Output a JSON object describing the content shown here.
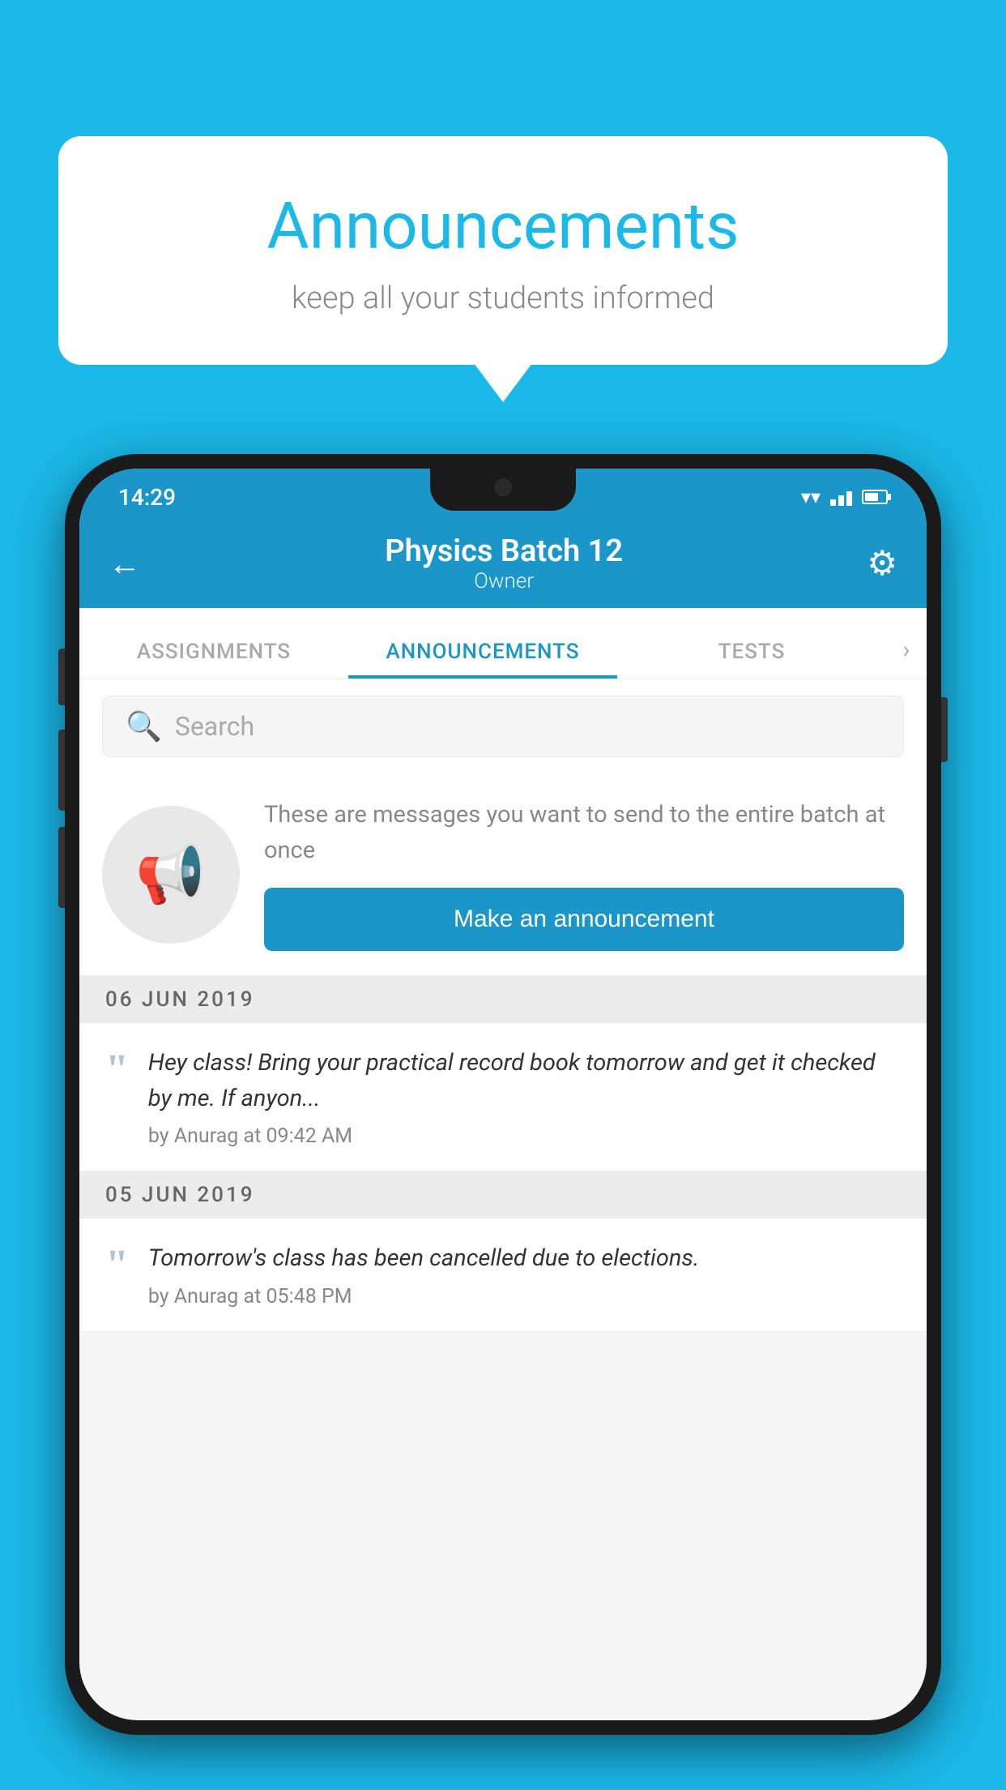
{
  "background_color": "#1BB8E8",
  "speech_bubble": {
    "title": "Announcements",
    "subtitle": "keep all your students informed"
  },
  "phone": {
    "status_bar": {
      "time": "14:29"
    },
    "app_bar": {
      "title": "Physics Batch 12",
      "subtitle": "Owner",
      "back_label": "←",
      "gear_label": "⚙"
    },
    "tabs": [
      {
        "label": "ASSIGNMENTS",
        "active": false
      },
      {
        "label": "ANNOUNCEMENTS",
        "active": true
      },
      {
        "label": "TESTS",
        "active": false
      }
    ],
    "search": {
      "placeholder": "Search"
    },
    "promo": {
      "description": "These are messages you want to send to the entire batch at once",
      "button_label": "Make an announcement"
    },
    "announcements": [
      {
        "date": "06  JUN  2019",
        "text": "Hey class! Bring your practical record book tomorrow and get it checked by me. If anyon...",
        "meta": "by Anurag at 09:42 AM"
      },
      {
        "date": "05  JUN  2019",
        "text": "Tomorrow's class has been cancelled due to elections.",
        "meta": "by Anurag at 05:48 PM"
      }
    ]
  }
}
